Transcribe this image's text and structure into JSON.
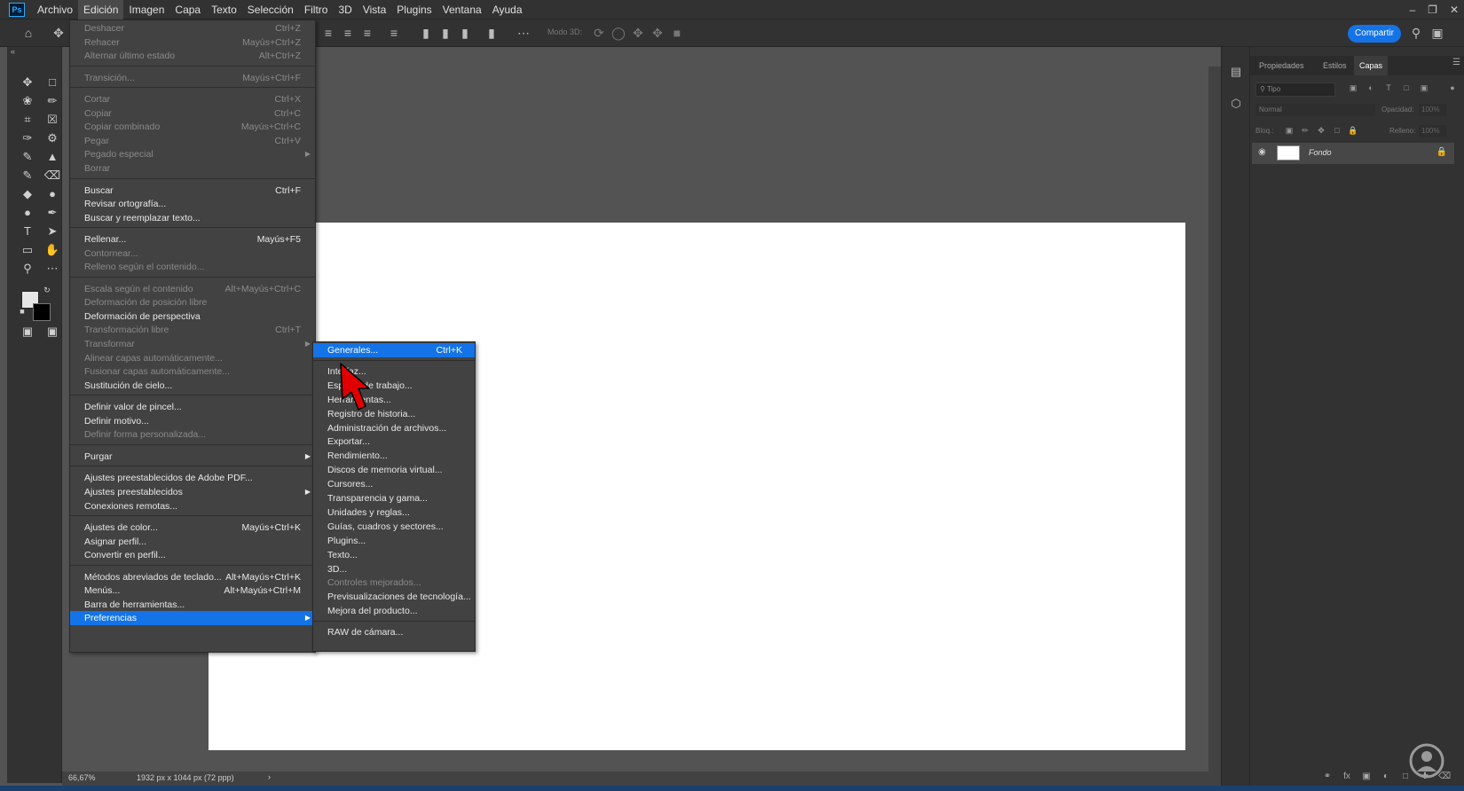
{
  "menubar": {
    "logo": "Ps",
    "items": [
      "Archivo",
      "Edición",
      "Imagen",
      "Capa",
      "Texto",
      "Selección",
      "Filtro",
      "3D",
      "Vista",
      "Plugins",
      "Ventana",
      "Ayuda"
    ],
    "active_index": 1
  },
  "optbar": {
    "modo3d": "Modo 3D:",
    "share": "Compartir"
  },
  "statusbar": {
    "zoom": "66,67%",
    "doc_info": "1932 px x 1044 px (72 ppp)",
    "arrow": "›"
  },
  "layers_panel": {
    "tabs": [
      "Propiedades",
      "Estilos",
      "Capas"
    ],
    "active_tab": 2,
    "filter_placeholder": "Tipo",
    "blend_mode": "Normal",
    "opacity_label": "Opacidad:",
    "opacity_value": "100%",
    "lock_label": "Bloq.:",
    "fill_label": "Relleno:",
    "fill_value": "100%",
    "layer_name": "Fondo"
  },
  "edit_menu": [
    {
      "label": "Deshacer",
      "shortcut": "Ctrl+Z",
      "disabled": true
    },
    {
      "label": "Rehacer",
      "shortcut": "Mayús+Ctrl+Z",
      "disabled": true
    },
    {
      "label": "Alternar último estado",
      "shortcut": "Alt+Ctrl+Z",
      "disabled": true
    },
    {
      "sep": true
    },
    {
      "label": "Transición...",
      "shortcut": "Mayús+Ctrl+F",
      "disabled": true
    },
    {
      "sep": true
    },
    {
      "label": "Cortar",
      "shortcut": "Ctrl+X",
      "disabled": true
    },
    {
      "label": "Copiar",
      "shortcut": "Ctrl+C",
      "disabled": true
    },
    {
      "label": "Copiar combinado",
      "shortcut": "Mayús+Ctrl+C",
      "disabled": true
    },
    {
      "label": "Pegar",
      "shortcut": "Ctrl+V",
      "disabled": true
    },
    {
      "label": "Pegado especial",
      "shortcut": "",
      "disabled": true,
      "submenu": true
    },
    {
      "label": "Borrar",
      "shortcut": "",
      "disabled": true
    },
    {
      "sep": true
    },
    {
      "label": "Buscar",
      "shortcut": "Ctrl+F",
      "disabled": false
    },
    {
      "label": "Revisar ortografía...",
      "shortcut": "",
      "disabled": false
    },
    {
      "label": "Buscar y reemplazar texto...",
      "shortcut": "",
      "disabled": false
    },
    {
      "sep": true
    },
    {
      "label": "Rellenar...",
      "shortcut": "Mayús+F5",
      "disabled": false
    },
    {
      "label": "Contornear...",
      "shortcut": "",
      "disabled": true
    },
    {
      "label": "Relleno según el contenido...",
      "shortcut": "",
      "disabled": true
    },
    {
      "sep": true
    },
    {
      "label": "Escala según el contenido",
      "shortcut": "Alt+Mayús+Ctrl+C",
      "disabled": true
    },
    {
      "label": "Deformación de posición libre",
      "shortcut": "",
      "disabled": true
    },
    {
      "label": "Deformación de perspectiva",
      "shortcut": "",
      "disabled": false
    },
    {
      "label": "Transformación libre",
      "shortcut": "Ctrl+T",
      "disabled": true
    },
    {
      "label": "Transformar",
      "shortcut": "",
      "disabled": true,
      "submenu": true
    },
    {
      "label": "Alinear capas automáticamente...",
      "shortcut": "",
      "disabled": true
    },
    {
      "label": "Fusionar capas automáticamente...",
      "shortcut": "",
      "disabled": true
    },
    {
      "label": "Sustitución de cielo...",
      "shortcut": "",
      "disabled": false
    },
    {
      "sep": true
    },
    {
      "label": "Definir valor de pincel...",
      "shortcut": "",
      "disabled": false
    },
    {
      "label": "Definir motivo...",
      "shortcut": "",
      "disabled": false
    },
    {
      "label": "Definir forma personalizada...",
      "shortcut": "",
      "disabled": true
    },
    {
      "sep": true
    },
    {
      "label": "Purgar",
      "shortcut": "",
      "disabled": false,
      "submenu": true
    },
    {
      "sep": true
    },
    {
      "label": "Ajustes preestablecidos de Adobe PDF...",
      "shortcut": "",
      "disabled": false
    },
    {
      "label": "Ajustes preestablecidos",
      "shortcut": "",
      "disabled": false,
      "submenu": true
    },
    {
      "label": "Conexiones remotas...",
      "shortcut": "",
      "disabled": false
    },
    {
      "sep": true
    },
    {
      "label": "Ajustes de color...",
      "shortcut": "Mayús+Ctrl+K",
      "disabled": false
    },
    {
      "label": "Asignar perfil...",
      "shortcut": "",
      "disabled": false
    },
    {
      "label": "Convertir en perfil...",
      "shortcut": "",
      "disabled": false
    },
    {
      "sep": true
    },
    {
      "label": "Métodos abreviados de teclado...",
      "shortcut": "Alt+Mayús+Ctrl+K",
      "disabled": false
    },
    {
      "label": "Menús...",
      "shortcut": "Alt+Mayús+Ctrl+M",
      "disabled": false
    },
    {
      "label": "Barra de herramientas...",
      "shortcut": "",
      "disabled": false
    },
    {
      "label": "Preferencias",
      "shortcut": "",
      "disabled": false,
      "submenu": true,
      "highlight": true
    }
  ],
  "pref_menu": [
    {
      "label": "Generales...",
      "shortcut": "Ctrl+K",
      "highlight": true
    },
    {
      "sep": true
    },
    {
      "label": "Interfaz...",
      "shortcut": ""
    },
    {
      "label": "Espacio de trabajo...",
      "shortcut": ""
    },
    {
      "label": "Herramientas...",
      "shortcut": ""
    },
    {
      "label": "Registro de historia...",
      "shortcut": ""
    },
    {
      "label": "Administración de archivos...",
      "shortcut": ""
    },
    {
      "label": "Exportar...",
      "shortcut": ""
    },
    {
      "label": "Rendimiento...",
      "shortcut": ""
    },
    {
      "label": "Discos de memoria virtual...",
      "shortcut": ""
    },
    {
      "label": "Cursores...",
      "shortcut": ""
    },
    {
      "label": "Transparencia y gama...",
      "shortcut": ""
    },
    {
      "label": "Unidades y reglas...",
      "shortcut": ""
    },
    {
      "label": "Guías, cuadros y sectores...",
      "shortcut": ""
    },
    {
      "label": "Plugins...",
      "shortcut": ""
    },
    {
      "label": "Texto...",
      "shortcut": ""
    },
    {
      "label": "3D...",
      "shortcut": ""
    },
    {
      "label": "Controles mejorados...",
      "shortcut": "",
      "disabled": true
    },
    {
      "label": "Previsualizaciones de tecnología...",
      "shortcut": ""
    },
    {
      "label": "Mejora del producto...",
      "shortcut": ""
    },
    {
      "sep": true
    },
    {
      "label": "RAW de cámara...",
      "shortcut": ""
    }
  ],
  "colors": {
    "accent": "#1473e6",
    "pointer": "#e00000"
  }
}
